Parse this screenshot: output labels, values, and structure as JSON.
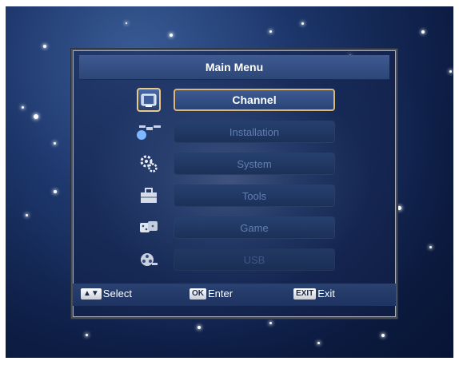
{
  "window": {
    "title": "Main Menu"
  },
  "menu": {
    "items": [
      {
        "label": "Channel",
        "icon": "tv-icon",
        "selected": true
      },
      {
        "label": "Installation",
        "icon": "satellite-icon",
        "selected": false
      },
      {
        "label": "System",
        "icon": "gears-icon",
        "selected": false
      },
      {
        "label": "Tools",
        "icon": "toolbox-icon",
        "selected": false
      },
      {
        "label": "Game",
        "icon": "dice-icon",
        "selected": false
      },
      {
        "label": "USB",
        "icon": "film-reel-icon",
        "selected": false
      }
    ]
  },
  "footer": {
    "select": {
      "key": "▲▼",
      "label": "Select"
    },
    "enter": {
      "key": "OK",
      "label": "Enter"
    },
    "exit": {
      "key": "EXIT",
      "label": "Exit"
    }
  },
  "colors": {
    "accent_border": "#d9b87a",
    "panel_bg": "#1c3158",
    "inactive_text": "#5f7fb3"
  }
}
